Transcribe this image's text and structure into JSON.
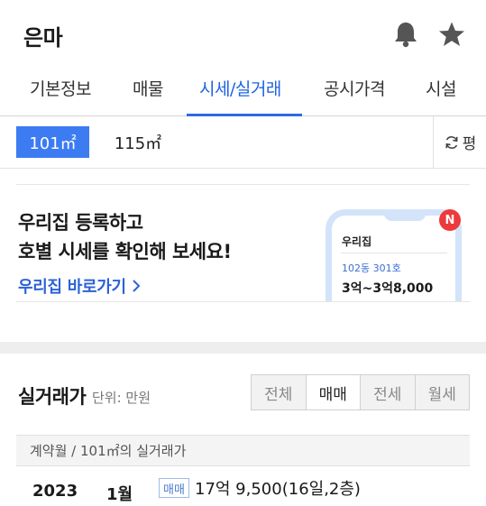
{
  "header": {
    "title": "은마",
    "icons": [
      "bell-icon",
      "star-icon"
    ]
  },
  "tabs": [
    {
      "label": "기본정보",
      "active": false
    },
    {
      "label": "매물",
      "active": false
    },
    {
      "label": "시세/실거래",
      "active": true
    },
    {
      "label": "공시가격",
      "active": false
    },
    {
      "label": "시설",
      "active": false
    }
  ],
  "area": {
    "options": [
      "101㎡",
      "115㎡"
    ],
    "selected": "101㎡",
    "unit_toggle_label": "평"
  },
  "promo": {
    "line1": "우리집 등록하고",
    "line2": "호별 시세를 확인해 보세요!",
    "link": "우리집 바로가기",
    "phone_title": "우리집",
    "phone_sub": "102동 301호",
    "phone_price": "3억~3억8,000",
    "badge": "N"
  },
  "transactions": {
    "title": "실거래가",
    "unit": "단위: 만원",
    "filters": [
      "전체",
      "매매",
      "전세",
      "월세"
    ],
    "selected_filter": "매매",
    "table_header": "계약월 / 101㎡의 실거래가",
    "rows": [
      {
        "year": "2023",
        "month": "1월",
        "type": "매매",
        "price": "17억 9,500(16일,2층)"
      }
    ]
  },
  "colors": {
    "accent": "#2f6be3",
    "selected_chip": "#3d7bf2",
    "link": "#2c62d6",
    "badge": "#ec3a3a"
  }
}
